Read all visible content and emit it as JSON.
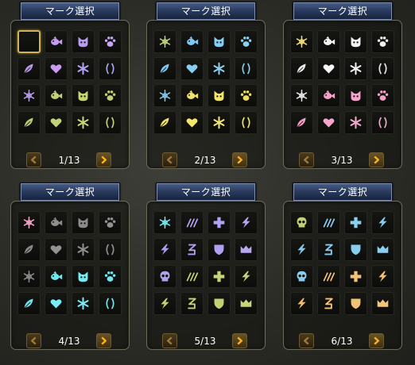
{
  "panel_title": "マーク選択",
  "panels": [
    {
      "page": "1/13",
      "selected_cell": 0,
      "icons": [
        {
          "name": "empty",
          "color": ""
        },
        {
          "name": "fish-icon",
          "color": "#c49cf2"
        },
        {
          "name": "cat-icon",
          "color": "#b69df0"
        },
        {
          "name": "paw-icon",
          "color": "#c8a8f4"
        },
        {
          "name": "leaf-icon",
          "color": "#b598e6"
        },
        {
          "name": "heart-icon",
          "color": "#c69bf0"
        },
        {
          "name": "star-icon",
          "color": "#b4a2f4"
        },
        {
          "name": "parens-icon",
          "color": "#a9a6ea"
        },
        {
          "name": "snowflake-icon",
          "color": "#b49ce8"
        },
        {
          "name": "fish-icon",
          "color": "#c0d07a"
        },
        {
          "name": "cat-icon",
          "color": "#c6d472"
        },
        {
          "name": "paw-icon",
          "color": "#c2cf74"
        },
        {
          "name": "leaf-icon",
          "color": "#b8cc72"
        },
        {
          "name": "heart-icon",
          "color": "#bfd479"
        },
        {
          "name": "star-icon",
          "color": "#c8d67c"
        },
        {
          "name": "parens-icon",
          "color": "#c3cf82"
        }
      ]
    },
    {
      "page": "2/13",
      "selected_cell": -1,
      "icons": [
        {
          "name": "snowflake-icon",
          "color": "#bcd27a"
        },
        {
          "name": "fish-icon",
          "color": "#7fc8ef"
        },
        {
          "name": "cat-icon",
          "color": "#86cdef"
        },
        {
          "name": "paw-icon",
          "color": "#8ad0f0"
        },
        {
          "name": "leaf-icon",
          "color": "#82c8ea"
        },
        {
          "name": "heart-icon",
          "color": "#86cdef"
        },
        {
          "name": "star-icon",
          "color": "#8ad2f2"
        },
        {
          "name": "parens-icon",
          "color": "#86cae8"
        },
        {
          "name": "snowflake-icon",
          "color": "#80c4e6"
        },
        {
          "name": "fish-icon",
          "color": "#f0e36a"
        },
        {
          "name": "cat-icon",
          "color": "#f2e56c"
        },
        {
          "name": "paw-icon",
          "color": "#f0de60"
        },
        {
          "name": "leaf-icon",
          "color": "#ecdf6a"
        },
        {
          "name": "heart-icon",
          "color": "#f4e668"
        },
        {
          "name": "star-icon",
          "color": "#f4e774"
        },
        {
          "name": "parens-icon",
          "color": "#eee370"
        }
      ]
    },
    {
      "page": "3/13",
      "selected_cell": -1,
      "icons": [
        {
          "name": "snowflake-icon",
          "color": "#eedd78"
        },
        {
          "name": "fish-icon",
          "color": "#f4f4f4"
        },
        {
          "name": "cat-icon",
          "color": "#f2f2f2"
        },
        {
          "name": "paw-icon",
          "color": "#f0f0f0"
        },
        {
          "name": "leaf-icon",
          "color": "#ececec"
        },
        {
          "name": "heart-icon",
          "color": "#f6f6f6"
        },
        {
          "name": "star-icon",
          "color": "#f2f2f2"
        },
        {
          "name": "parens-icon",
          "color": "#e8e8e8"
        },
        {
          "name": "snowflake-icon",
          "color": "#e6e6e6"
        },
        {
          "name": "fish-icon",
          "color": "#f2a2c8"
        },
        {
          "name": "cat-icon",
          "color": "#f4a4cc"
        },
        {
          "name": "paw-icon",
          "color": "#f2a0c6"
        },
        {
          "name": "leaf-icon",
          "color": "#f0a0c4"
        },
        {
          "name": "heart-icon",
          "color": "#f4a6cc"
        },
        {
          "name": "star-icon",
          "color": "#f4a8cc"
        },
        {
          "name": "parens-icon",
          "color": "#eeaacc"
        }
      ]
    },
    {
      "page": "4/13",
      "selected_cell": -1,
      "icons": [
        {
          "name": "snowflake-icon",
          "color": "#f0a4c6"
        },
        {
          "name": "fish-icon",
          "color": "#8e8e8e"
        },
        {
          "name": "cat-icon",
          "color": "#8c8c8c"
        },
        {
          "name": "paw-icon",
          "color": "#929292"
        },
        {
          "name": "leaf-icon",
          "color": "#8a8a8a"
        },
        {
          "name": "heart-icon",
          "color": "#939393"
        },
        {
          "name": "star-icon",
          "color": "#8f8f8f"
        },
        {
          "name": "parens-icon",
          "color": "#909090"
        },
        {
          "name": "snowflake-icon",
          "color": "#8a8a8a"
        },
        {
          "name": "fish-icon",
          "color": "#6ee8f0"
        },
        {
          "name": "cat-icon",
          "color": "#74eaf2"
        },
        {
          "name": "paw-icon",
          "color": "#70e6ee"
        },
        {
          "name": "leaf-icon",
          "color": "#6ee2ea"
        },
        {
          "name": "heart-icon",
          "color": "#76ecf4"
        },
        {
          "name": "star-icon",
          "color": "#7aecf4"
        },
        {
          "name": "parens-icon",
          "color": "#78e6ee"
        }
      ]
    },
    {
      "page": "5/13",
      "selected_cell": -1,
      "icons": [
        {
          "name": "snowflake-icon",
          "color": "#72e6ee"
        },
        {
          "name": "claw-icon",
          "color": "#b6a0f0"
        },
        {
          "name": "cross-icon",
          "color": "#b2a2f4"
        },
        {
          "name": "bolt-icon",
          "color": "#b8a6f2"
        },
        {
          "name": "bolt-icon",
          "color": "#aaa2f0"
        },
        {
          "name": "rune-icon",
          "color": "#b4a0f0"
        },
        {
          "name": "shield-icon",
          "color": "#b2a0f0"
        },
        {
          "name": "crown-icon",
          "color": "#b8a6f2"
        },
        {
          "name": "skull-icon",
          "color": "#b2a2ee"
        },
        {
          "name": "claw-icon",
          "color": "#c4d074"
        },
        {
          "name": "cross-icon",
          "color": "#c6d676"
        },
        {
          "name": "bolt-icon",
          "color": "#c4d07a"
        },
        {
          "name": "bolt-icon",
          "color": "#c2cf74"
        },
        {
          "name": "rune-icon",
          "color": "#c6d274"
        },
        {
          "name": "shield-icon",
          "color": "#c4d078"
        },
        {
          "name": "crown-icon",
          "color": "#c8d478"
        }
      ]
    },
    {
      "page": "6/13",
      "selected_cell": -1,
      "icons": [
        {
          "name": "skull-icon",
          "color": "#c4d076"
        },
        {
          "name": "claw-icon",
          "color": "#8acdf0"
        },
        {
          "name": "cross-icon",
          "color": "#8ad0f2"
        },
        {
          "name": "bolt-icon",
          "color": "#86ccef"
        },
        {
          "name": "bolt-icon",
          "color": "#84c8ec"
        },
        {
          "name": "rune-icon",
          "color": "#8acdf0"
        },
        {
          "name": "shield-icon",
          "color": "#88ccee"
        },
        {
          "name": "crown-icon",
          "color": "#8ad0f2"
        },
        {
          "name": "skull-icon",
          "color": "#88ccee"
        },
        {
          "name": "claw-icon",
          "color": "#f2c074"
        },
        {
          "name": "cross-icon",
          "color": "#f4c476"
        },
        {
          "name": "bolt-icon",
          "color": "#f2c070"
        },
        {
          "name": "bolt-icon",
          "color": "#f0bc6e"
        },
        {
          "name": "rune-icon",
          "color": "#f4c478"
        },
        {
          "name": "shield-icon",
          "color": "#f2c274"
        },
        {
          "name": "crown-icon",
          "color": "#f4c478"
        }
      ]
    }
  ],
  "arrows": {
    "prev": "arrow-left-icon",
    "next": "arrow-right-icon",
    "prev_color": "#a07a36",
    "next_color": "#ffb020"
  }
}
